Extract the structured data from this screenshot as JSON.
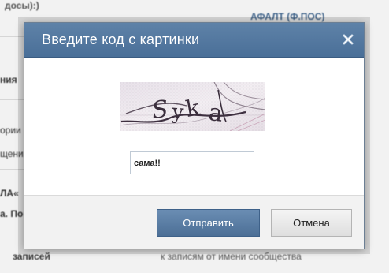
{
  "background": {
    "top_left": "досы):)",
    "top_right": "АФАЛТ (Ф.ПОС)",
    "left_lines": [
      "ния",
      "ории и",
      "щени",
      "ЛА«",
      "а. По"
    ],
    "bottom_left": "записей",
    "bottom_right": "к записям от имени сообщества"
  },
  "dialog": {
    "title": "Введите код с картинки",
    "close_icon": "close-icon",
    "captcha": {
      "text": "Syka",
      "alt": "captcha-image"
    },
    "input": {
      "value": "сама!!",
      "placeholder": ""
    },
    "buttons": {
      "submit": "Отправить",
      "cancel": "Отмена"
    }
  },
  "colors": {
    "header": "#4a6f98",
    "submit_button": "#4c6f96",
    "link": "#45688e"
  }
}
